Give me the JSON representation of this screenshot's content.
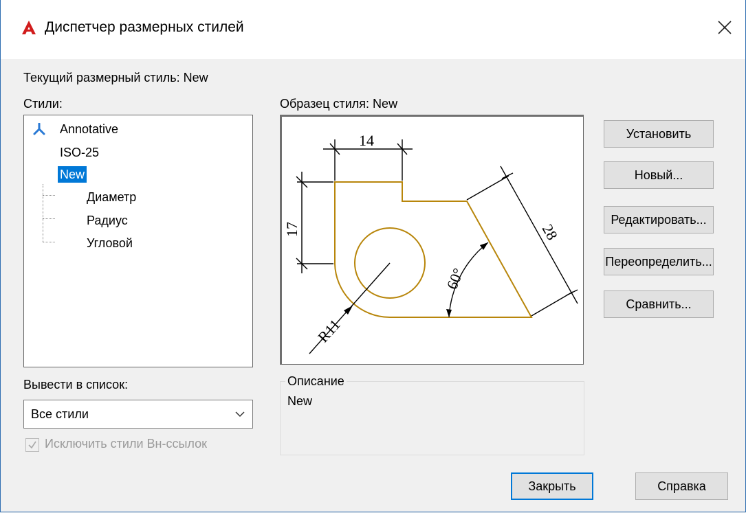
{
  "window": {
    "title": "Диспетчер размерных стилей",
    "close_glyph": "✕",
    "accent_color": "#0078d7",
    "app_icon_color": "#d11c1c"
  },
  "current_style_label": "Текущий размерный стиль: New",
  "styles": {
    "label": "Стили:",
    "items": [
      {
        "label": "Annotative",
        "icon": "annotative-icon"
      },
      {
        "label": "ISO-25"
      },
      {
        "label": "New",
        "selected": true
      },
      {
        "label": "Диаметр",
        "child": true
      },
      {
        "label": "Радиус",
        "child": true
      },
      {
        "label": "Угловой",
        "child": true
      }
    ]
  },
  "preview": {
    "label": "Образец стиля: New",
    "dims": {
      "top": "14",
      "left": "17",
      "diag": "28",
      "angle": "60°",
      "radius": "R11"
    },
    "line_color": "#b8860b"
  },
  "buttons": {
    "set": "Установить",
    "new": "Новый...",
    "edit": "Редактировать...",
    "override": "Переопределить...",
    "compare": "Сравнить...",
    "close": "Закрыть",
    "help": "Справка"
  },
  "list_filter": {
    "label": "Вывести в список:",
    "value": "Все стили"
  },
  "exclude_xref": {
    "label": "Исключить стили Вн-ссылок",
    "checked": true,
    "enabled": false
  },
  "description": {
    "legend": "Описание",
    "text": "New"
  }
}
